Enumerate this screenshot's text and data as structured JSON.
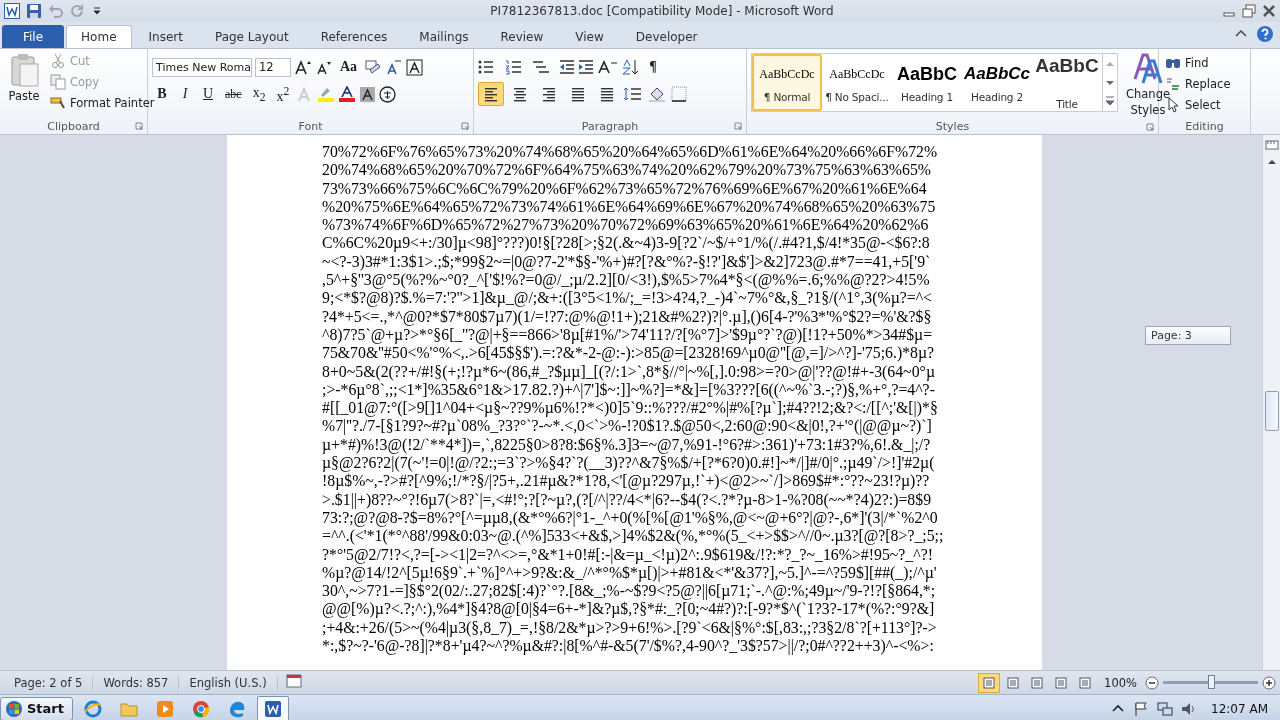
{
  "window": {
    "title": "PI7812367813.doc [Compatibility Mode]  -  Microsoft Word"
  },
  "tabs": [
    {
      "label": "File",
      "kind": "file",
      "selected": false
    },
    {
      "label": "Home",
      "kind": "tab",
      "selected": true
    },
    {
      "label": "Insert",
      "kind": "tab",
      "selected": false
    },
    {
      "label": "Page Layout",
      "kind": "tab",
      "selected": false
    },
    {
      "label": "References",
      "kind": "tab",
      "selected": false
    },
    {
      "label": "Mailings",
      "kind": "tab",
      "selected": false
    },
    {
      "label": "Review",
      "kind": "tab",
      "selected": false
    },
    {
      "label": "View",
      "kind": "tab",
      "selected": false
    },
    {
      "label": "Developer",
      "kind": "tab",
      "selected": false
    }
  ],
  "clipboard": {
    "title": "Clipboard",
    "paste": "Paste",
    "items": [
      {
        "label": "Cut",
        "disabled": true
      },
      {
        "label": "Copy",
        "disabled": true
      },
      {
        "label": "Format Painter",
        "disabled": false
      }
    ]
  },
  "font": {
    "title": "Font",
    "font_name": "Times New Roma",
    "font_size": "12",
    "change_case": "Aa",
    "format_buttons": [
      "B",
      "I",
      "U",
      "abc",
      "x$_{2}$",
      "x$^{2}$"
    ]
  },
  "paragraph": {
    "title": "Paragraph",
    "show_marks": "¶",
    "align_buttons": [
      {
        "selected": true
      },
      {
        "selected": false
      },
      {
        "selected": false
      },
      {
        "selected": false
      },
      {
        "selected": false
      }
    ]
  },
  "styles": {
    "title": "Styles",
    "items": [
      {
        "preview": "AaBbCcDc",
        "label": "¶ Normal",
        "kind": "body",
        "selected": true
      },
      {
        "preview": "AaBbCcDc",
        "label": "¶ No Spaci...",
        "kind": "body",
        "selected": false
      },
      {
        "preview": "AaBbC",
        "label": "Heading 1",
        "kind": "heading",
        "selected": false
      },
      {
        "preview": "AaBbCc",
        "label": "Heading 2",
        "kind": "italic",
        "selected": false
      },
      {
        "preview": "AaBbC",
        "label": "Title",
        "kind": "title",
        "selected": false
      }
    ],
    "change_styles": [
      "Change",
      "Styles"
    ]
  },
  "editing": {
    "title": "Editing",
    "items": [
      {
        "label": "Find",
        "kind": "find"
      },
      {
        "label": "Replace",
        "kind": "replace"
      },
      {
        "label": "Select",
        "kind": "select"
      }
    ]
  },
  "document": {
    "lines": [
      "70%72%6F%76%65%73%20%74%68%65%20%64%65%6D%61%6E%64%20%66%6F%72%",
      "20%74%68%65%20%70%72%6F%64%75%63%74%20%62%79%20%73%75%63%63%65%",
      "73%73%66%75%6C%6C%79%20%6F%62%73%65%72%76%69%6E%67%20%61%6E%64",
      "%20%75%6E%64%65%72%73%74%61%6E%64%69%6E%67%20%74%68%65%20%63%75",
      "%73%74%6F%6D%65%72%27%73%20%70%72%69%63%65%20%61%6E%64%20%62%6",
      "C%6C%20µ9<+:/30]µ<98]°???)0!§[?28[>;§2(.&~4)3-9[?2`/~$/+°1/%(/.#4?1,$/4!*35@-<$6?:8",
      "~<?-3)3#*1:3$1>.;$;*99§2~=|0@?7-2'*$§-'%+)#?[?&°%?-§!?']&$']>&2]723@.#*7==41,+5['9`",
      ",5^+§''3@°5(%?%~°0?_^['$!%?=0@/_;µ/2.2][0/<3!),$%5>7%4*§<(@%%=.6;%%@?2?>4!5%",
      "9;<*$?@8)?$.%=7:'?''>1]&µ_@/;&+:([3°5<1%/;_=!3>4?4,?_-)4`~7%°&,§_?1§/(^1°,3(%µ?=^<",
      "?4*+5<=.,*^@0?*$7*80$7µ7)(1/=!?7:@%@!1+);21&#%2?)?|°.µ],()6[4-?'%3*'%°$2?=%'&?$§",
      "^8)7?5`@+µ?>*°§6[_''?@|+§==866>'8µ[#1%/'>74'11?/?[%°7]>'$9µ°?`?@)[!1?+50%*>34#$µ=",
      "75&70&''#50<%'°%<,.>6[45$§$').=:?&*-2-@:-):>85@=[2328!69^µ0@''[@,=]/>^?]-'75;6.)*8µ?",
      "8+0~5&(2(??+/#!§(+;!?µ*6~(86,#_?$µµ]_[(?/:1>`,8*§//°|~%[,].0:98>=?0>@|'??@!#+-3(64~0°µ",
      ";>-*6µ°8`,;;<1*]%35&6°1&>17.82.?)+^|7']$~:]]~%?]=*&]=[%3???[6((^~%`3.-;?)§,%+°,?=4^?-",
      "#[[_01@7:°([>9[]1^04+<µ§~??9%µ6%!?*<)0]5`9::%???/#2°%|#%[?µ`];#4??!2;&?<:/[[^;'&[|)*§",
      "%7|''?./7-[§1?9?~#?µ`08%_?3?°`?-~*.<,0<`>%-!?0$1?.$@50<,2:60@:90<&|0!,?+'°(|@@µ~?)`]",
      "µ+*#)%!3@(!2/`**4*])=,`,8225§0>8?8:$6§%.3]3=~@7,%91-!°6?#>:361)'+73:1#3?%,6!.&_|;/?",
      "µ§@2?6?2|(7(~'!=0|!@/?2:;=3`?>%§4?`?(__3)??^&7§%$/+[?*6?0)0.#!]~*/|]#/0|°.;µ49`/>!]'#2µ(",
      "!8µ$%~,-?>#?[^9%;!/*?§/|?5+,.21#µ&?*1?8,<'[@µ?297µ,!`+)<@2>~`/]>869$#*:°??~23!?µ)??",
      ">.$1||+)8??~°?!6µ7(>8?`|=,<#!°;?[?~µ?,(?[/^|??/4<*|6?--$4(?<.?*?µ-8>1-%?08(~~*?4)2?:)=8$9",
      "73:?;@?@8-?$=8%?°[^=µµ8,(&*°%6?|°1-_^+0(%[%[@1'%§%,@<~@+6°?|@?-,6*]'(3|/*`%2^0",
      "=^^.(<'*1(*°^88'/99&0:03~@.(^%]533<+&$,>]4%$2&(%,*°%(5_<+>$$>^//0~.µ3?[@?[8>?_;5;;",
      "?*°'5@2/7!?<,?=[-><1|2=?^<>=,°&*1+0!#[:-|&=µ_<!µ)2^:.9$619&/!?:*?_?~_16%>#!95~?_^?!",
      "%µ?@14/!2^[5µ!6§9`.+`%]°^+>9?&:&_/^*°%$*µ[)|>+#81&<*'&37?],~5.]^-=^?59$][##(_);/^µ'",
      "30^,~>7?1-=]§$°2(02/:.27;82$[:4)?`°?.[8&_;%-~$?9<?5@?||6[µ71;`-.^@:%;49µ~/'9-?!?[§864,*;",
      "@@[%)µ?<.?;^:),%4*]§4?8@[0|§4=6+-*]&?µ$,?§*#:_?[0;~4#?)?:[-9?*$^(`1?3?-17*(%?:°9?&]",
      ";+4&:+26/(5>~(%4|µ3(§,8_7)_=,!§8/2&*µ>?>9+6!%>.[?9`<6&|§%°:$[,83:,;?3§2/8`?[+113°]?->",
      "*:,$?~?-'6@-?8]|?*8+'µ4?~^?%µ&#?:|8[%^#-&5(7'/$%?,4-90^?_'3$?57>||/?;0#^??2++3)^-<%>:"
    ]
  },
  "scroll_tooltip": "Page: 3",
  "status_bar": {
    "page": "Page: 2 of 5",
    "words": "Words: 857",
    "language": "English (U.S.)",
    "views": [
      {
        "selected": true
      },
      {
        "selected": false
      },
      {
        "selected": false
      },
      {
        "selected": false
      },
      {
        "selected": false
      }
    ],
    "zoom": "100%",
    "zoom_level": {
      "level": 0.5
    }
  },
  "taskbar": {
    "start": "Start",
    "apps": [
      {
        "kind": "ie",
        "selected": false
      },
      {
        "kind": "folder",
        "selected": false
      },
      {
        "kind": "media",
        "selected": false
      },
      {
        "kind": "chrome",
        "selected": false
      },
      {
        "kind": "edge",
        "selected": false
      },
      {
        "kind": "word",
        "selected": true
      }
    ],
    "clock": "12:07 AM"
  }
}
